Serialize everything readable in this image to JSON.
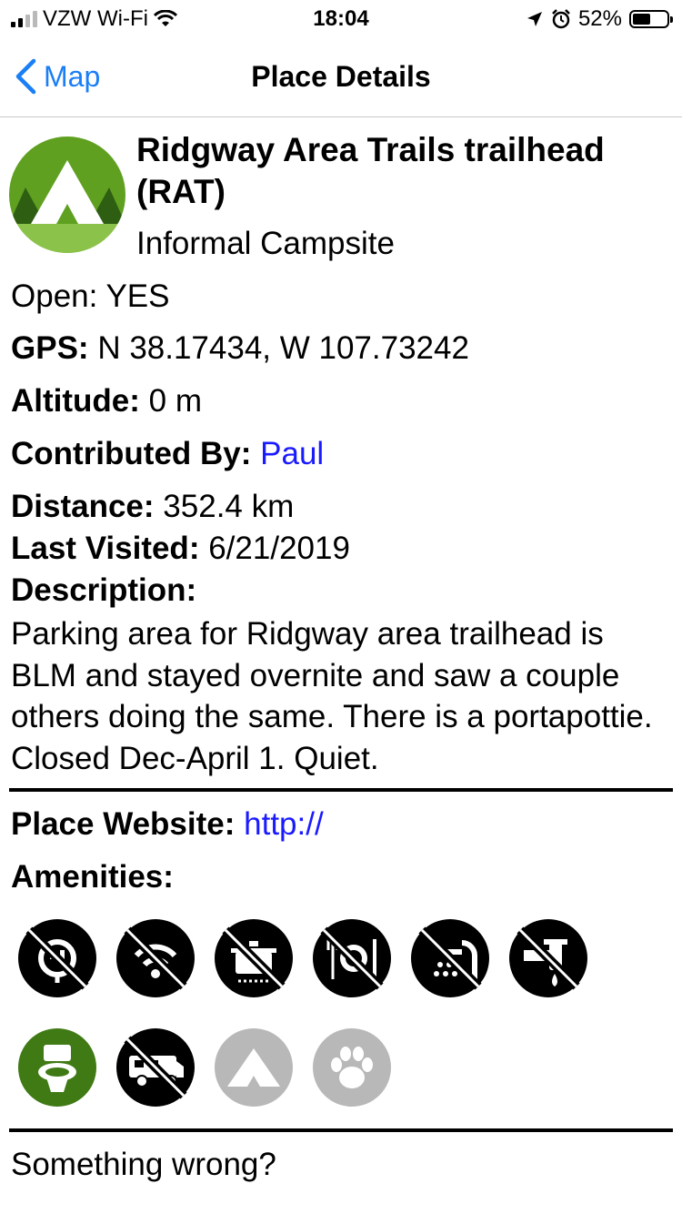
{
  "status_bar": {
    "carrier": "VZW Wi-Fi",
    "time": "18:04",
    "battery": "52%",
    "battery_level": 0.52
  },
  "nav": {
    "back_label": "Map",
    "title": "Place Details"
  },
  "place": {
    "name": "Ridgway Area Trails trailhead (RAT)",
    "type": "Informal Campsite",
    "open_label": "Open:",
    "open_value": "YES",
    "gps_label": "GPS:",
    "gps_value": "N 38.17434, W 107.73242",
    "altitude_label": "Altitude:",
    "altitude_value": "0 m",
    "contributed_label": "Contributed By:",
    "contributed_value": "Paul",
    "distance_label": "Distance:",
    "distance_value": "352.4 km",
    "last_visited_label": "Last Visited:",
    "last_visited_value": "6/21/2019",
    "description_label": "Description:",
    "description": "Parking area for Ridgway area trailhead is BLM and stayed overnite and saw a couple others doing the same.  There is a portapottie.  Closed Dec-April 1.  Quiet.",
    "website_label": "Place Website:",
    "website_value": "http://",
    "amenities_label": "Amenities:",
    "report_label": "Something wrong?"
  },
  "amenities": [
    {
      "icon": "electricity-icon",
      "state": "unavailable"
    },
    {
      "icon": "wifi-icon",
      "state": "unavailable"
    },
    {
      "icon": "kitchen-icon",
      "state": "unavailable"
    },
    {
      "icon": "restaurant-icon",
      "state": "unavailable"
    },
    {
      "icon": "showers-icon",
      "state": "unavailable"
    },
    {
      "icon": "water-icon",
      "state": "unavailable"
    },
    {
      "icon": "toilets-icon",
      "state": "available"
    },
    {
      "icon": "rv-icon",
      "state": "unavailable"
    },
    {
      "icon": "tent-icon",
      "state": "unknown"
    },
    {
      "icon": "pets-icon",
      "state": "unknown"
    }
  ],
  "colors": {
    "accent": "#1a7ff5",
    "link": "#1a1aff",
    "available": "#3f7a14",
    "unknown": "#b8b8b8",
    "logo_green": "#5fa020"
  }
}
